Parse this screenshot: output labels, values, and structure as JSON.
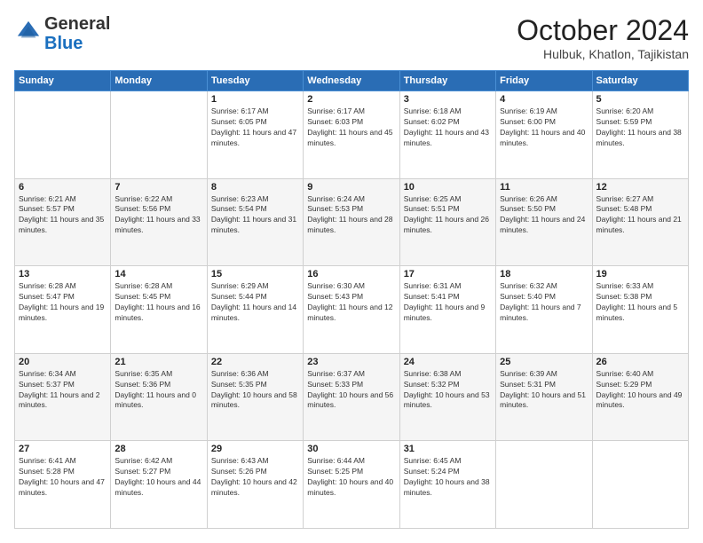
{
  "header": {
    "logo": {
      "line1": "General",
      "line2": "Blue"
    },
    "title": "October 2024",
    "location": "Hulbuk, Khatlon, Tajikistan"
  },
  "weekdays": [
    "Sunday",
    "Monday",
    "Tuesday",
    "Wednesday",
    "Thursday",
    "Friday",
    "Saturday"
  ],
  "weeks": [
    [
      {
        "day": "",
        "info": ""
      },
      {
        "day": "",
        "info": ""
      },
      {
        "day": "1",
        "info": "Sunrise: 6:17 AM\nSunset: 6:05 PM\nDaylight: 11 hours and 47 minutes."
      },
      {
        "day": "2",
        "info": "Sunrise: 6:17 AM\nSunset: 6:03 PM\nDaylight: 11 hours and 45 minutes."
      },
      {
        "day": "3",
        "info": "Sunrise: 6:18 AM\nSunset: 6:02 PM\nDaylight: 11 hours and 43 minutes."
      },
      {
        "day": "4",
        "info": "Sunrise: 6:19 AM\nSunset: 6:00 PM\nDaylight: 11 hours and 40 minutes."
      },
      {
        "day": "5",
        "info": "Sunrise: 6:20 AM\nSunset: 5:59 PM\nDaylight: 11 hours and 38 minutes."
      }
    ],
    [
      {
        "day": "6",
        "info": "Sunrise: 6:21 AM\nSunset: 5:57 PM\nDaylight: 11 hours and 35 minutes."
      },
      {
        "day": "7",
        "info": "Sunrise: 6:22 AM\nSunset: 5:56 PM\nDaylight: 11 hours and 33 minutes."
      },
      {
        "day": "8",
        "info": "Sunrise: 6:23 AM\nSunset: 5:54 PM\nDaylight: 11 hours and 31 minutes."
      },
      {
        "day": "9",
        "info": "Sunrise: 6:24 AM\nSunset: 5:53 PM\nDaylight: 11 hours and 28 minutes."
      },
      {
        "day": "10",
        "info": "Sunrise: 6:25 AM\nSunset: 5:51 PM\nDaylight: 11 hours and 26 minutes."
      },
      {
        "day": "11",
        "info": "Sunrise: 6:26 AM\nSunset: 5:50 PM\nDaylight: 11 hours and 24 minutes."
      },
      {
        "day": "12",
        "info": "Sunrise: 6:27 AM\nSunset: 5:48 PM\nDaylight: 11 hours and 21 minutes."
      }
    ],
    [
      {
        "day": "13",
        "info": "Sunrise: 6:28 AM\nSunset: 5:47 PM\nDaylight: 11 hours and 19 minutes."
      },
      {
        "day": "14",
        "info": "Sunrise: 6:28 AM\nSunset: 5:45 PM\nDaylight: 11 hours and 16 minutes."
      },
      {
        "day": "15",
        "info": "Sunrise: 6:29 AM\nSunset: 5:44 PM\nDaylight: 11 hours and 14 minutes."
      },
      {
        "day": "16",
        "info": "Sunrise: 6:30 AM\nSunset: 5:43 PM\nDaylight: 11 hours and 12 minutes."
      },
      {
        "day": "17",
        "info": "Sunrise: 6:31 AM\nSunset: 5:41 PM\nDaylight: 11 hours and 9 minutes."
      },
      {
        "day": "18",
        "info": "Sunrise: 6:32 AM\nSunset: 5:40 PM\nDaylight: 11 hours and 7 minutes."
      },
      {
        "day": "19",
        "info": "Sunrise: 6:33 AM\nSunset: 5:38 PM\nDaylight: 11 hours and 5 minutes."
      }
    ],
    [
      {
        "day": "20",
        "info": "Sunrise: 6:34 AM\nSunset: 5:37 PM\nDaylight: 11 hours and 2 minutes."
      },
      {
        "day": "21",
        "info": "Sunrise: 6:35 AM\nSunset: 5:36 PM\nDaylight: 11 hours and 0 minutes."
      },
      {
        "day": "22",
        "info": "Sunrise: 6:36 AM\nSunset: 5:35 PM\nDaylight: 10 hours and 58 minutes."
      },
      {
        "day": "23",
        "info": "Sunrise: 6:37 AM\nSunset: 5:33 PM\nDaylight: 10 hours and 56 minutes."
      },
      {
        "day": "24",
        "info": "Sunrise: 6:38 AM\nSunset: 5:32 PM\nDaylight: 10 hours and 53 minutes."
      },
      {
        "day": "25",
        "info": "Sunrise: 6:39 AM\nSunset: 5:31 PM\nDaylight: 10 hours and 51 minutes."
      },
      {
        "day": "26",
        "info": "Sunrise: 6:40 AM\nSunset: 5:29 PM\nDaylight: 10 hours and 49 minutes."
      }
    ],
    [
      {
        "day": "27",
        "info": "Sunrise: 6:41 AM\nSunset: 5:28 PM\nDaylight: 10 hours and 47 minutes."
      },
      {
        "day": "28",
        "info": "Sunrise: 6:42 AM\nSunset: 5:27 PM\nDaylight: 10 hours and 44 minutes."
      },
      {
        "day": "29",
        "info": "Sunrise: 6:43 AM\nSunset: 5:26 PM\nDaylight: 10 hours and 42 minutes."
      },
      {
        "day": "30",
        "info": "Sunrise: 6:44 AM\nSunset: 5:25 PM\nDaylight: 10 hours and 40 minutes."
      },
      {
        "day": "31",
        "info": "Sunrise: 6:45 AM\nSunset: 5:24 PM\nDaylight: 10 hours and 38 minutes."
      },
      {
        "day": "",
        "info": ""
      },
      {
        "day": "",
        "info": ""
      }
    ]
  ]
}
